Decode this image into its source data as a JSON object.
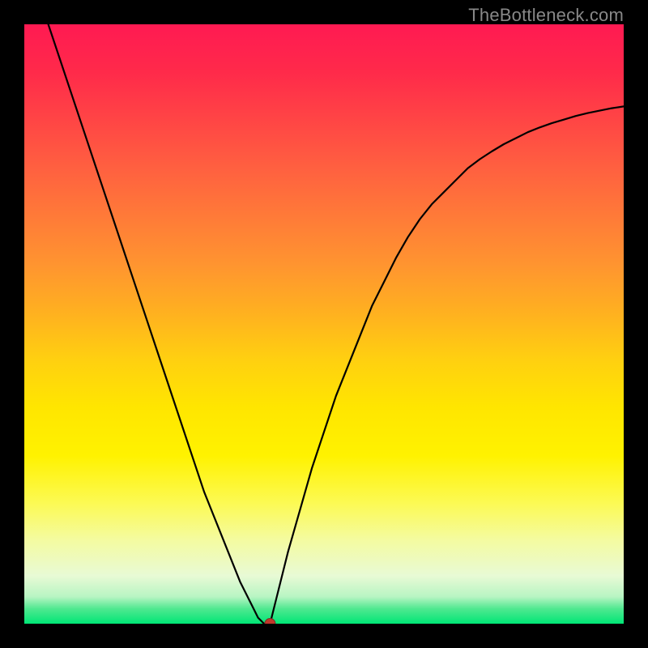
{
  "attribution": "TheBottleneck.com",
  "colors": {
    "frame": "#000000",
    "gradient_top": "#ff1a52",
    "gradient_mid": "#ffe600",
    "gradient_bottom": "#00e676",
    "curve": "#000000",
    "marker": "#c0392b"
  },
  "chart_data": {
    "type": "line",
    "title": "",
    "xlabel": "",
    "ylabel": "",
    "xlim": [
      0,
      100
    ],
    "ylim": [
      0,
      100
    ],
    "x": [
      4,
      6,
      8,
      10,
      12,
      14,
      16,
      18,
      20,
      22,
      24,
      26,
      28,
      30,
      32,
      34,
      36,
      37,
      38,
      39,
      40,
      41,
      42,
      44,
      46,
      48,
      50,
      52,
      54,
      56,
      58,
      60,
      62,
      64,
      66,
      68,
      70,
      72,
      74,
      76,
      78,
      80,
      82,
      84,
      86,
      88,
      90,
      92,
      94,
      96,
      98,
      100
    ],
    "values": [
      100,
      94,
      88,
      82,
      76,
      70,
      64,
      58,
      52,
      46,
      40,
      34,
      28,
      22,
      17,
      12,
      7,
      5,
      3,
      1,
      0,
      0,
      4,
      12,
      19,
      26,
      32,
      38,
      43,
      48,
      53,
      57,
      61,
      64.5,
      67.5,
      70,
      72,
      74,
      76,
      77.5,
      78.8,
      80,
      81,
      82,
      82.8,
      83.5,
      84.1,
      84.7,
      85.2,
      85.6,
      86,
      86.3
    ],
    "marker": {
      "x": 41,
      "y": 0
    },
    "notes": "V-shaped bottleneck curve over rainbow gradient; minimum near x≈41 where curve touches bottom (green)."
  }
}
